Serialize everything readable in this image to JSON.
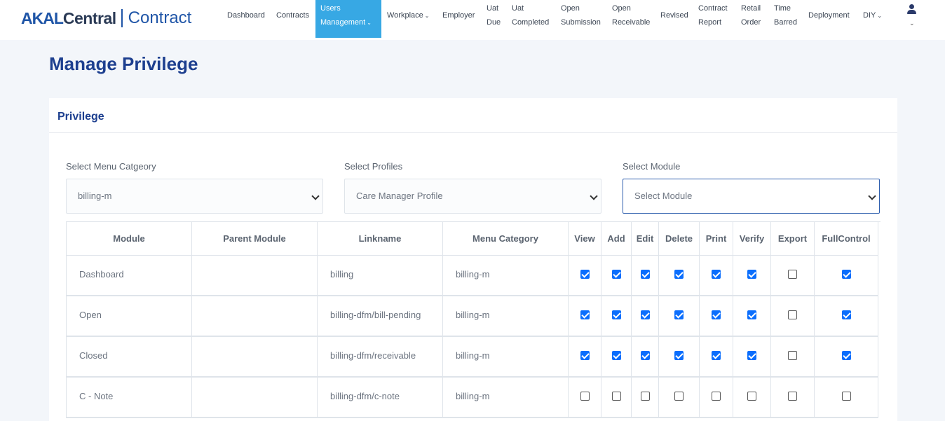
{
  "brand": {
    "part1": "AKAL",
    "part2": "Central",
    "part3": "Contract"
  },
  "nav": {
    "items": [
      {
        "line1": "Dashboard",
        "line2": ""
      },
      {
        "line1": "Contracts",
        "line2": ""
      },
      {
        "line1": "Users",
        "line2": "Management"
      },
      {
        "line1": "Workplace",
        "line2": ""
      },
      {
        "line1": "Employer",
        "line2": ""
      },
      {
        "line1": "Uat",
        "line2": "Due"
      },
      {
        "line1": "Uat",
        "line2": "Completed"
      },
      {
        "line1": "Open",
        "line2": "Submission"
      },
      {
        "line1": "Open",
        "line2": "Receivable"
      },
      {
        "line1": "Revised",
        "line2": ""
      },
      {
        "line1": "Contract",
        "line2": "Report"
      },
      {
        "line1": "Retail",
        "line2": "Order"
      },
      {
        "line1": "Time",
        "line2": "Barred"
      },
      {
        "line1": "Deployment",
        "line2": ""
      },
      {
        "line1": "DIY",
        "line2": ""
      }
    ],
    "caret_glyph": "⌄",
    "user_icon": "user-icon"
  },
  "page": {
    "title": "Manage Privilege"
  },
  "card": {
    "title": "Privilege",
    "filters": {
      "menu_category": {
        "label": "Select Menu Catgeory",
        "value": "billing-m"
      },
      "profiles": {
        "label": "Select Profiles",
        "value": "Care Manager Profile"
      },
      "module": {
        "label": "Select Module",
        "value": "Select Module"
      }
    }
  },
  "table": {
    "headers": [
      "Module",
      "Parent Module",
      "Linkname",
      "Menu Category",
      "View",
      "Add",
      "Edit",
      "Delete",
      "Print",
      "Verify",
      "Export",
      "FullControl"
    ],
    "rows": [
      {
        "module": "Dashboard",
        "parent": "",
        "link": "billing",
        "category": "billing-m",
        "perms": [
          true,
          true,
          true,
          true,
          true,
          true,
          false,
          true
        ]
      },
      {
        "module": "Open",
        "parent": "",
        "link": "billing-dfm/bill-pending",
        "category": "billing-m",
        "perms": [
          true,
          true,
          true,
          true,
          true,
          true,
          false,
          true
        ]
      },
      {
        "module": "Closed",
        "parent": "",
        "link": "billing-dfm/receivable",
        "category": "billing-m",
        "perms": [
          true,
          true,
          true,
          true,
          true,
          true,
          false,
          true
        ]
      },
      {
        "module": "C - Note",
        "parent": "",
        "link": "billing-dfm/c-note",
        "category": "billing-m",
        "perms": [
          false,
          false,
          false,
          false,
          false,
          false,
          false,
          false
        ]
      }
    ]
  },
  "colors": {
    "accent": "#37a8e4",
    "title": "#1d3f8f",
    "checkbox": "#0b6efd"
  }
}
